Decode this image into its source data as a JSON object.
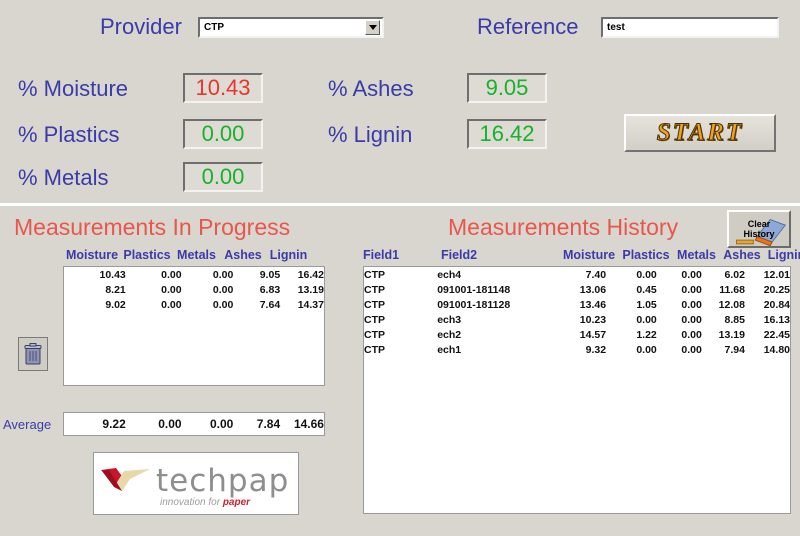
{
  "header": {
    "provider_label": "Provider",
    "provider_value": "CTP",
    "reference_label": "Reference",
    "reference_value": "test",
    "reference_placeholder": "",
    "start_label": "START"
  },
  "metrics": [
    {
      "label": "% Moisture",
      "value": "10.43",
      "color": "#e8362b"
    },
    {
      "label": "% Plastics",
      "value": "0.00",
      "color": "#17b22a"
    },
    {
      "label": "% Metals",
      "value": "0.00",
      "color": "#17b22a"
    },
    {
      "label": "% Ashes",
      "value": "9.05",
      "color": "#17b22a"
    },
    {
      "label": "% Lignin",
      "value": "16.42",
      "color": "#17b22a"
    }
  ],
  "progress": {
    "title": "Measurements In Progress",
    "columns": [
      "Moisture",
      "Plastics",
      "Metals",
      "Ashes",
      "Lignin"
    ],
    "rows": [
      [
        "10.43",
        "0.00",
        "0.00",
        "9.05",
        "16.42"
      ],
      [
        "8.21",
        "0.00",
        "0.00",
        "6.83",
        "13.19"
      ],
      [
        "9.02",
        "0.00",
        "0.00",
        "7.64",
        "14.37"
      ]
    ],
    "average_label": "Average",
    "average": [
      "9.22",
      "0.00",
      "0.00",
      "7.84",
      "14.66"
    ],
    "delete_icon": "trash-icon"
  },
  "history": {
    "title": "Measurements History",
    "clear_label_line1": "Clear",
    "clear_label_line2": "History",
    "columns": [
      "Field1",
      "Field2",
      "Moisture",
      "Plastics",
      "Metals",
      "Ashes",
      "Lignin"
    ],
    "rows": [
      [
        "CTP",
        "ech4",
        "7.40",
        "0.00",
        "0.00",
        "6.02",
        "12.01"
      ],
      [
        "CTP",
        "091001-181148",
        "13.06",
        "0.45",
        "0.00",
        "11.68",
        "20.25"
      ],
      [
        "CTP",
        "091001-181128",
        "13.46",
        "1.05",
        "0.00",
        "12.08",
        "20.84"
      ],
      [
        "CTP",
        "ech3",
        "10.23",
        "0.00",
        "0.00",
        "8.85",
        "16.13"
      ],
      [
        "CTP",
        "ech2",
        "14.57",
        "1.22",
        "0.00",
        "13.19",
        "22.45"
      ],
      [
        "CTP",
        "ech1",
        "9.32",
        "0.00",
        "0.00",
        "7.94",
        "14.80"
      ]
    ]
  },
  "logo": {
    "word": "techpap",
    "tagline_prefix": "innovation for ",
    "tagline_accent": "paper"
  },
  "colors": {
    "background": "#d9d6cf",
    "label_blue": "#3b3ba8",
    "title_red": "#e8574c",
    "value_green": "#17b22a",
    "value_red": "#e8362b",
    "start_gold": "#f0a323"
  }
}
